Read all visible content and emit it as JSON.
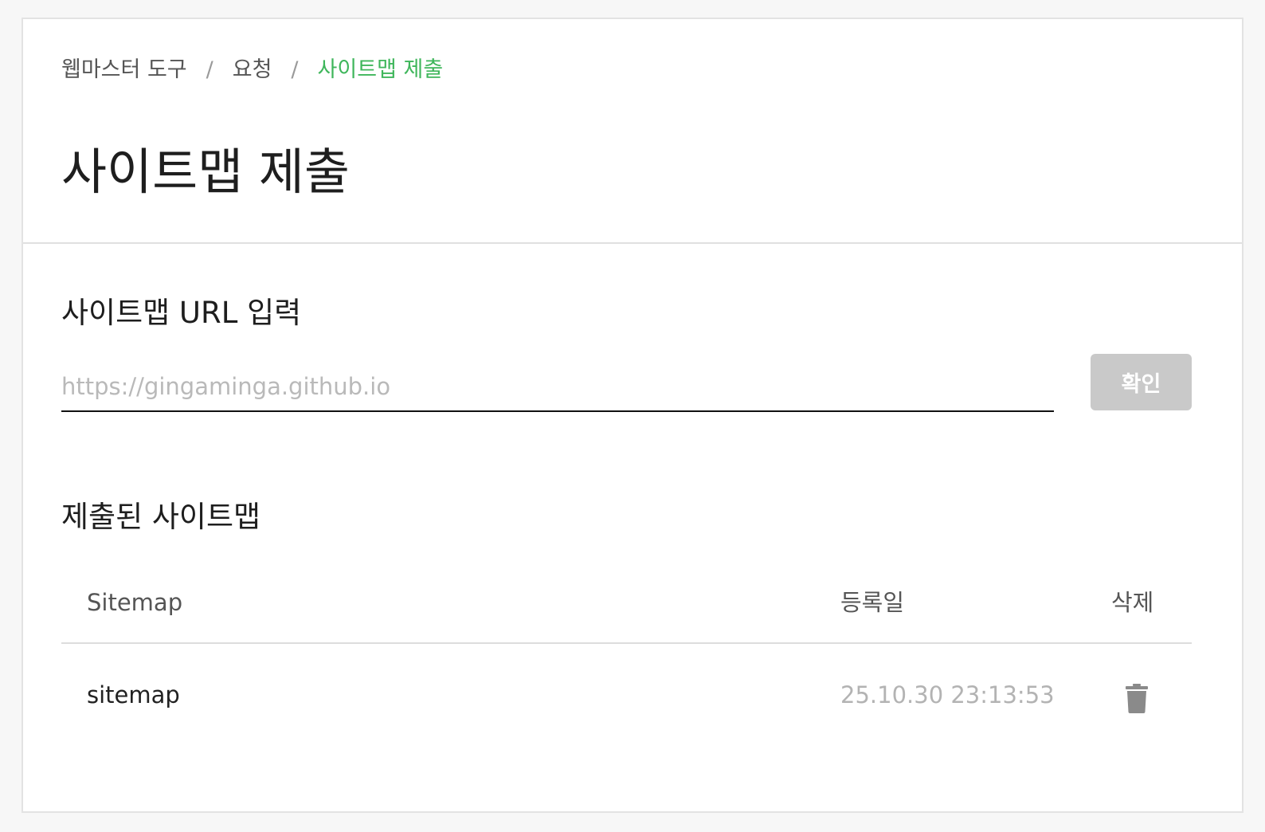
{
  "breadcrumb": {
    "items": [
      "웹마스터 도구",
      "요청",
      "사이트맵 제출"
    ],
    "separator": "/"
  },
  "page": {
    "title": "사이트맵 제출"
  },
  "url_section": {
    "title": "사이트맵 URL 입력",
    "input_value": "",
    "input_placeholder": "https://gingaminga.github.io",
    "confirm_label": "확인"
  },
  "submitted": {
    "title": "제출된 사이트맵",
    "columns": {
      "sitemap": "Sitemap",
      "date": "등록일",
      "delete": "삭제"
    },
    "rows": [
      {
        "name": "sitemap",
        "date": "25.10.30 23:13:53",
        "delete_icon": "trash-icon"
      }
    ]
  },
  "colors": {
    "accent": "#3fb65b",
    "button_disabled": "#c9c9c9",
    "icon": "#8a8a8a"
  }
}
